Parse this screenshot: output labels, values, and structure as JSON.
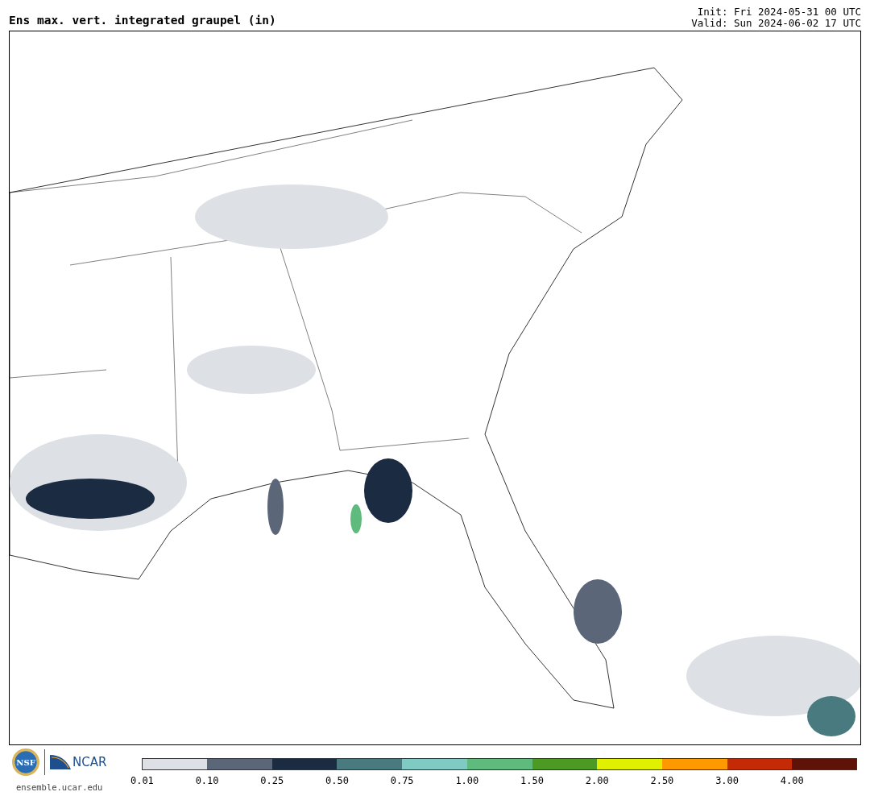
{
  "title": "Ens max. vert. integrated graupel (in)",
  "init": "Init: Fri 2024-05-31 00 UTC",
  "valid": "Valid: Sun 2024-06-02 17 UTC",
  "logos": [
    {
      "kind": "nsf",
      "text": "NSF"
    },
    {
      "kind": "ncar",
      "text": "NCAR"
    }
  ],
  "site": "ensemble.ucar.edu",
  "colorbar": {
    "segments": [
      {
        "label": "0.01",
        "color": "#dde1e5"
      },
      {
        "label": "0.10",
        "color": "#5b6778"
      },
      {
        "label": "0.25",
        "color": "#1b2b42"
      },
      {
        "label": "0.50",
        "color": "#497a80"
      },
      {
        "label": "0.75",
        "color": "#7fcbc4"
      },
      {
        "label": "1.00",
        "color": "#5fba7d"
      },
      {
        "label": "1.50",
        "color": "#4c9a23"
      },
      {
        "label": "2.00",
        "color": "#e1ef00"
      },
      {
        "label": "2.50",
        "color": "#ff9900"
      },
      {
        "label": "3.00",
        "color": "#c42a06"
      },
      {
        "label": "4.00",
        "color": "#5e1208"
      }
    ]
  }
}
